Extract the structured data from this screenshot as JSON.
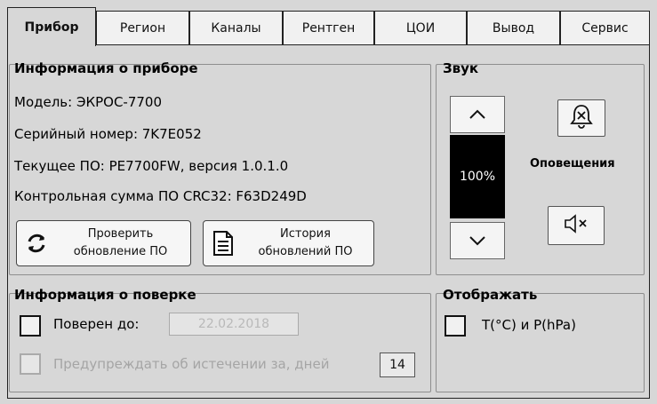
{
  "tabs": [
    {
      "label": "Прибор",
      "active": true
    },
    {
      "label": "Регион",
      "active": false
    },
    {
      "label": "Каналы",
      "active": false
    },
    {
      "label": "Рентген",
      "active": false
    },
    {
      "label": "ЦОИ",
      "active": false
    },
    {
      "label": "Вывод",
      "active": false
    },
    {
      "label": "Сервис",
      "active": false
    }
  ],
  "device_info": {
    "title": "Информация о приборе",
    "model": "Модель: ЭКРОС-7700",
    "serial": "Серийный номер: 7K7E052",
    "firmware": "Текущее ПО: PE7700FW, версия 1.0.1.0",
    "checksum": "Контрольная сумма ПО CRC32: F63D249D",
    "check_update_label": "Проверить обновление ПО",
    "history_label": "История обновлений ПО"
  },
  "sound": {
    "title": "Звук",
    "volume_text": "100%",
    "volume_percent": 100,
    "notifications_label": "Оповещения"
  },
  "calibration": {
    "title": "Информация о поверке",
    "verified_until_label": "Поверен до:",
    "verified_until_value": "22.02.2018",
    "verified_checked": false,
    "warn_label": "Предупреждать об истечении за, дней",
    "warn_days": "14",
    "warn_checked": false
  },
  "display": {
    "title": "Отображать",
    "tp_label": "T(°C) и P(hPa)",
    "tp_checked": false
  }
}
